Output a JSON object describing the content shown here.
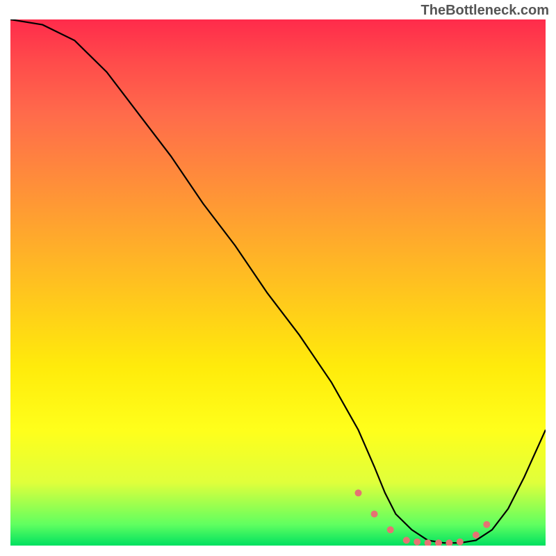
{
  "watermark": "TheBottleneck.com",
  "chart_data": {
    "type": "line",
    "title": "",
    "xlabel": "",
    "ylabel": "",
    "xlim": [
      0,
      100
    ],
    "ylim": [
      0,
      100
    ],
    "series": [
      {
        "name": "curve",
        "x": [
          0,
          6,
          12,
          18,
          24,
          30,
          36,
          42,
          48,
          54,
          60,
          65,
          68,
          70,
          72,
          75,
          78,
          81,
          84,
          87,
          90,
          93,
          96,
          100
        ],
        "values": [
          100,
          99,
          96,
          90,
          82,
          74,
          65,
          57,
          48,
          40,
          31,
          22,
          15,
          10,
          6,
          3,
          1,
          0.5,
          0.5,
          1,
          3,
          7,
          13,
          22
        ]
      }
    ],
    "markers": {
      "name": "dots",
      "color": "#e57373",
      "x": [
        65,
        68,
        71,
        74,
        76,
        78,
        80,
        82,
        84,
        87,
        89
      ],
      "values": [
        10,
        6,
        3,
        1,
        0.7,
        0.5,
        0.5,
        0.5,
        0.7,
        2,
        4
      ]
    },
    "gradient_stops": [
      {
        "pos": 0.0,
        "color": "#ff2b4b"
      },
      {
        "pos": 0.5,
        "color": "#ffd000"
      },
      {
        "pos": 0.9,
        "color": "#e0ff3b"
      },
      {
        "pos": 1.0,
        "color": "#00e060"
      }
    ]
  }
}
